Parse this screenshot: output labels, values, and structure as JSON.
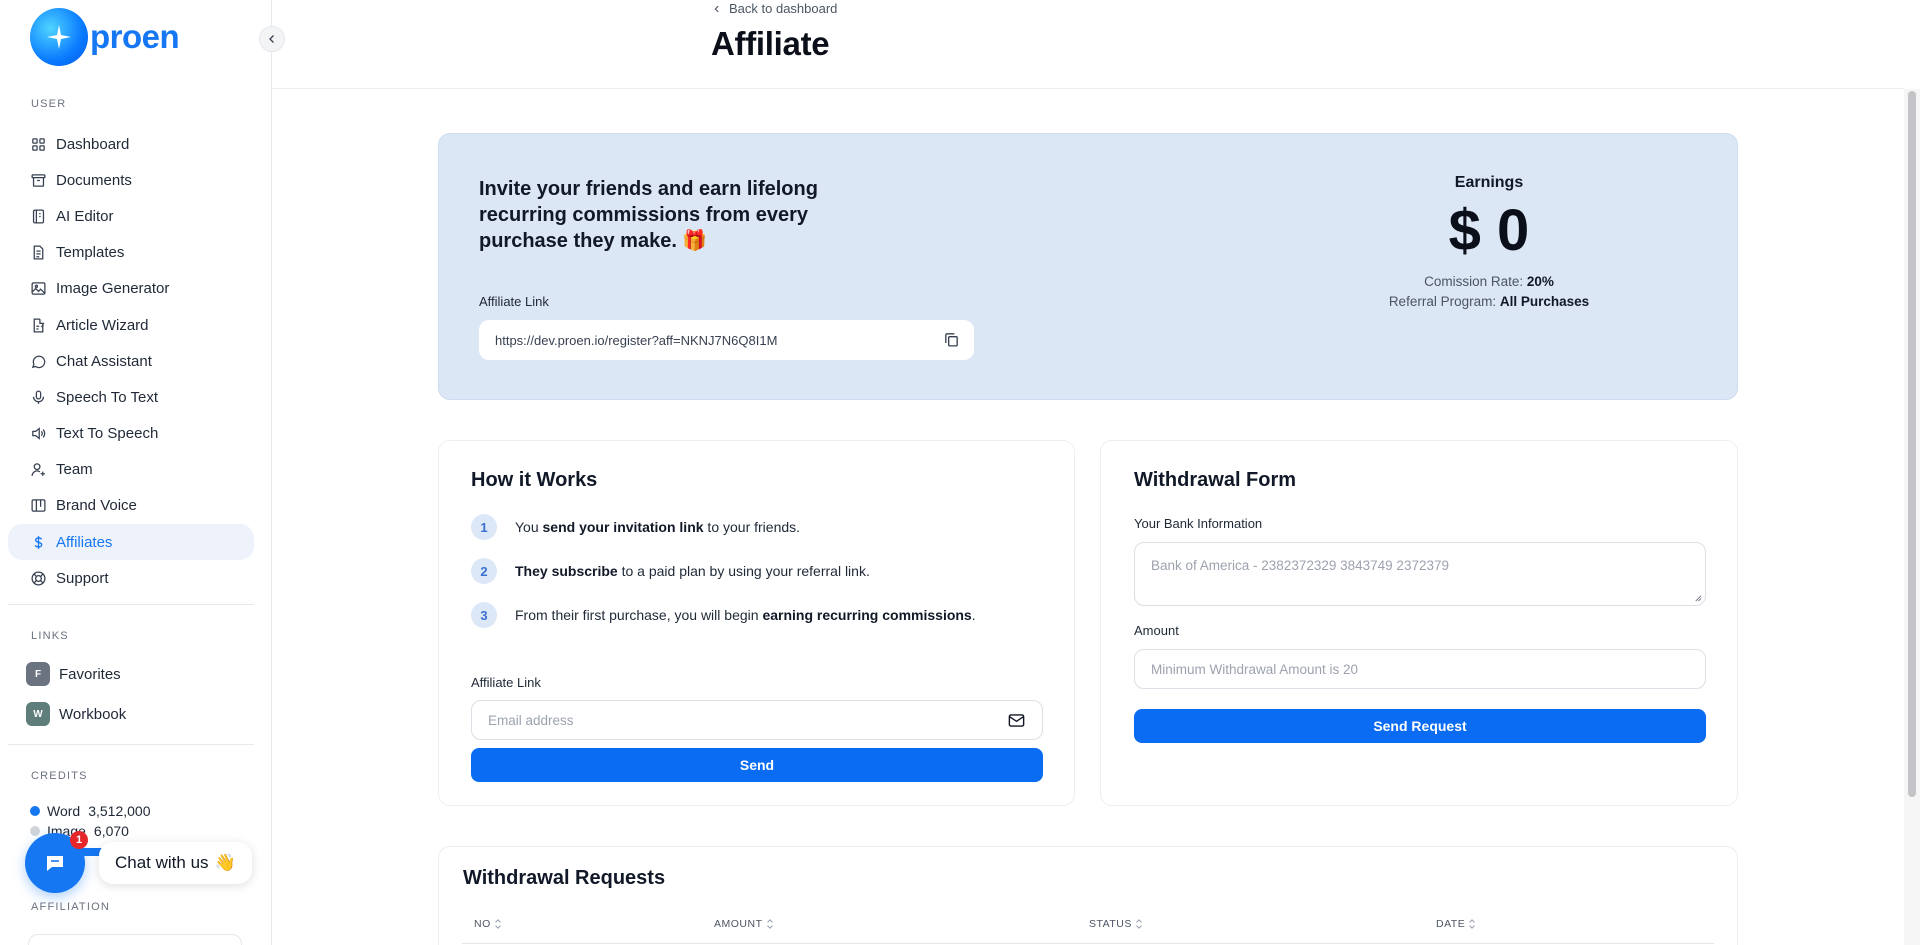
{
  "brand": {
    "name": "proen"
  },
  "sidebar": {
    "user_label": "USER",
    "items": [
      {
        "label": "Dashboard",
        "icon": "grid-icon"
      },
      {
        "label": "Documents",
        "icon": "archive-icon"
      },
      {
        "label": "AI Editor",
        "icon": "notebook-icon"
      },
      {
        "label": "Templates",
        "icon": "file-text-icon"
      },
      {
        "label": "Image Generator",
        "icon": "image-icon"
      },
      {
        "label": "Article Wizard",
        "icon": "file-edit-icon"
      },
      {
        "label": "Chat Assistant",
        "icon": "message-circle-icon"
      },
      {
        "label": "Speech To Text",
        "icon": "microphone-icon"
      },
      {
        "label": "Text To Speech",
        "icon": "volume-icon"
      },
      {
        "label": "Team",
        "icon": "user-plus-icon"
      },
      {
        "label": "Brand Voice",
        "icon": "layout-board-icon"
      },
      {
        "label": "Affiliates",
        "icon": "dollar-icon",
        "active": true
      },
      {
        "label": "Support",
        "icon": "lifebuoy-icon"
      }
    ],
    "links_label": "LINKS",
    "links": [
      {
        "label": "Favorites",
        "badge": "F",
        "color": "#6b7280"
      },
      {
        "label": "Workbook",
        "badge": "W",
        "color": "#5f7d7a"
      }
    ],
    "credits_label": "CREDITS",
    "credits": {
      "word_label": "Word",
      "word_value": "3,512,000",
      "image_label": "Image",
      "image_value": "6,070",
      "word_share": 0.998
    },
    "affiliation_label": "AFFILIATION"
  },
  "chat_widget": {
    "label": "Chat with us",
    "emoji": "👋",
    "badge_count": "1"
  },
  "header": {
    "back_label": "Back to dashboard",
    "title": "Affiliate"
  },
  "banner": {
    "heading": "Invite your friends and earn lifelong recurring commissions from every purchase they make. 🎁",
    "link_label": "Affiliate Link",
    "link_value": "https://dev.proen.io/register?aff=NKNJ7N6Q8I1M",
    "earnings_label": "Earnings",
    "earnings_amount": "$ 0",
    "commission_label": "Comission Rate:",
    "commission_value": "20%",
    "referral_label": "Referral Program:",
    "referral_value": "All Purchases"
  },
  "how_it_works": {
    "title": "How it Works",
    "steps": [
      {
        "num": "1",
        "pre": "You ",
        "bold": "send your invitation link",
        "post": " to your friends."
      },
      {
        "num": "2",
        "pre": "",
        "bold": "They subscribe",
        "post": " to a paid plan by using your referral link."
      },
      {
        "num": "3",
        "pre": "From their first purchase, you will begin ",
        "bold": "earning recurring commissions",
        "post": "."
      }
    ],
    "link_label": "Affiliate Link",
    "email_placeholder": "Email address",
    "send_label": "Send"
  },
  "withdrawal_form": {
    "title": "Withdrawal Form",
    "bank_label": "Your Bank Information",
    "bank_placeholder": "Bank of America - 2382372329 3843749 2372379",
    "amount_label": "Amount",
    "amount_placeholder": "Minimum Withdrawal Amount is 20",
    "submit_label": "Send Request"
  },
  "withdrawal_requests": {
    "title": "Withdrawal Requests",
    "columns": [
      "NO",
      "AMOUNT",
      "STATUS",
      "DATE"
    ]
  },
  "colors": {
    "primary": "#0a6cf2",
    "banner_bg": "#dbe7f5",
    "active_nav_bg": "#eef2fb"
  }
}
